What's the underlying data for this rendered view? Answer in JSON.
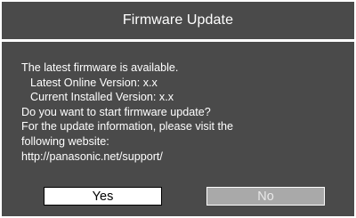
{
  "dialog": {
    "title": "Firmware Update",
    "lines": [
      "The latest firmware is available.",
      "Latest Online Version: x.x",
      "Current Installed Version: x.x",
      "Do you want to start firmware update?",
      "For the update information, please visit the",
      "following website:",
      "http://panasonic.net/support/"
    ],
    "buttons": {
      "yes": "Yes",
      "no": "No"
    },
    "colors": {
      "background": "#4a4a4a",
      "text": "#ffffff",
      "selected_button": "#ffffff",
      "unselected_button": "#a9a9a9"
    }
  }
}
